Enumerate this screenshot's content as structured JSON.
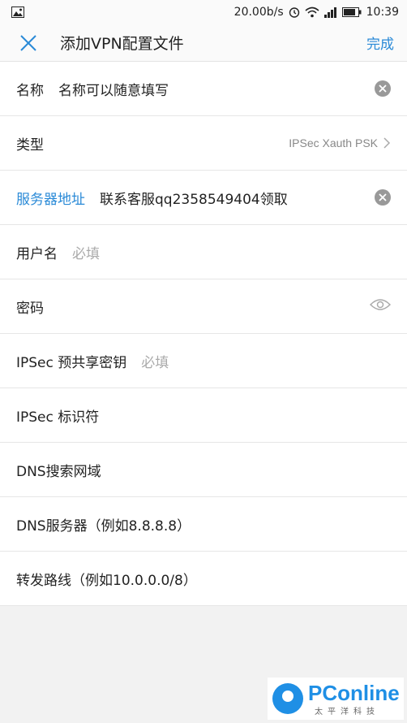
{
  "status_bar": {
    "speed": "20.00b/s",
    "time": "10:39"
  },
  "header": {
    "title": "添加VPN配置文件",
    "done_label": "完成"
  },
  "icons": {
    "close": "close-icon",
    "clear": "clear-icon",
    "chevron": "chevron-right-icon",
    "eye": "eye-icon"
  },
  "colors": {
    "accent": "#2a8ad7"
  },
  "form": {
    "name": {
      "label": "名称",
      "value": "名称可以随意填写"
    },
    "type": {
      "label": "类型",
      "value": "IPSec Xauth PSK"
    },
    "server": {
      "label": "服务器地址",
      "value": "联系客服qq2358549404领取"
    },
    "username": {
      "label": "用户名",
      "placeholder": "必填"
    },
    "password": {
      "label": "密码"
    },
    "psk": {
      "label": "IPSec 预共享密钥",
      "placeholder": "必填"
    },
    "identifier": {
      "label": "IPSec 标识符"
    },
    "dns_domain": {
      "label": "DNS搜索网域"
    },
    "dns_server": {
      "label": "DNS服务器（例如8.8.8.8）"
    },
    "routes": {
      "label": "转发路线（例如10.0.0.0/8）"
    }
  },
  "watermark": {
    "name": "PConline",
    "sub": "太平洋科技"
  }
}
